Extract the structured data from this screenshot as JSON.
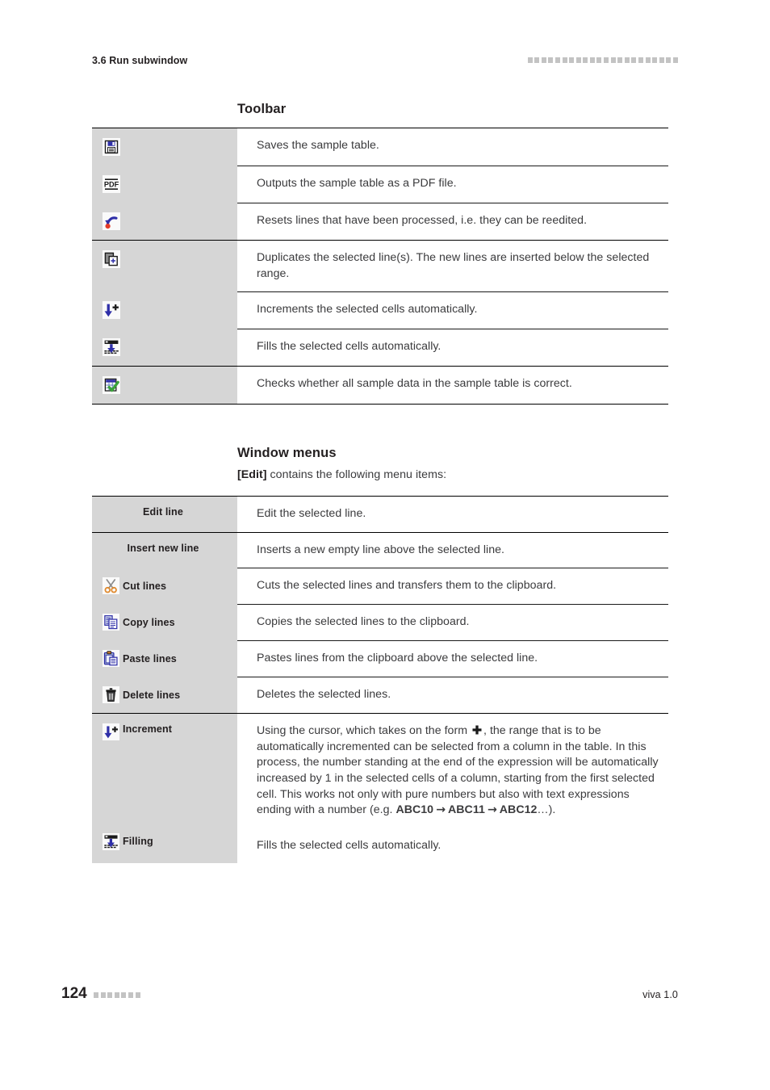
{
  "header": {
    "section_title": "3.6 Run subwindow",
    "decoration_squares": 22
  },
  "footer": {
    "page_number": "124",
    "decoration_squares": 7,
    "version": "viva 1.0"
  },
  "sections": {
    "toolbar_heading": "Toolbar",
    "window_menus_heading": "Window menus",
    "window_menus_intro_bold": "[Edit]",
    "window_menus_intro_rest": " contains the following menu items:"
  },
  "toolbar_table": {
    "groups": [
      {
        "rows": [
          {
            "icon": "save-floppy-icon",
            "description": "Saves the sample table."
          },
          {
            "icon": "pdf-export-icon",
            "description": "Outputs the sample table as a PDF file."
          },
          {
            "icon": "reset-undo-icon",
            "description": "Resets lines that have been processed, i.e. they can be reedited."
          }
        ]
      },
      {
        "rows": [
          {
            "icon": "duplicate-lines-icon",
            "description": "Duplicates the selected line(s). The new lines are inserted below the selected range."
          },
          {
            "icon": "increment-icon",
            "description": "Increments the selected cells automatically."
          },
          {
            "icon": "filling-icon",
            "description": "Fills the selected cells automatically."
          }
        ]
      },
      {
        "rows": [
          {
            "icon": "check-sample-data-icon",
            "description": "Checks whether all sample data in the sample table is correct."
          }
        ]
      }
    ]
  },
  "edit_menu_table": {
    "groups": [
      {
        "rows": [
          {
            "icon": null,
            "label": "Edit line",
            "description": "Edit the selected line."
          }
        ]
      },
      {
        "rows": [
          {
            "icon": null,
            "label": "Insert new line",
            "description": "Inserts a new empty line above the selected line."
          },
          {
            "icon": "cut-scissors-icon",
            "label": "Cut lines",
            "description": "Cuts the selected lines and transfers them to the clipboard."
          },
          {
            "icon": "copy-icon",
            "label": "Copy lines",
            "description": "Copies the selected lines to the clipboard."
          },
          {
            "icon": "paste-clipboard-icon",
            "label": "Paste lines",
            "description": "Pastes lines from the clipboard above the selected line."
          },
          {
            "icon": "delete-trash-icon",
            "label": "Delete lines",
            "description": "Deletes the selected lines."
          }
        ]
      },
      {
        "rows": [
          {
            "icon": "increment-icon",
            "label": "Increment",
            "description_part1": "Using the cursor, which takes on the form ",
            "inline_icon": "crosshair-cursor-icon",
            "description_part2": ", the range that is to be automatically incremented can be selected from a column in the table. In this process, the number standing at the end of the expression will be automatically increased by 1 in the selected cells of a column, starting from the first selected cell. This works not only with pure numbers but also with text expressions ending with a number (e.g. ",
            "example1": "ABC10",
            "arrow1": "→",
            "example2": "ABC11",
            "arrow2": "→",
            "example3": "ABC12",
            "description_part3": "…)."
          },
          {
            "icon": "filling-icon",
            "label": "Filling",
            "description": "Fills the selected cells automatically."
          }
        ]
      }
    ]
  },
  "colors": {
    "label_cell_background": "#d6d6d6",
    "rule": "#000000",
    "body_text": "#3b3b3d",
    "heading_text": "#231f20",
    "decoration_square": "#c3c3c3",
    "icon_blue": "#2f2fa8",
    "icon_green": "#3aa33a",
    "icon_red": "#e23b28",
    "icon_orange": "#e08a2e"
  }
}
